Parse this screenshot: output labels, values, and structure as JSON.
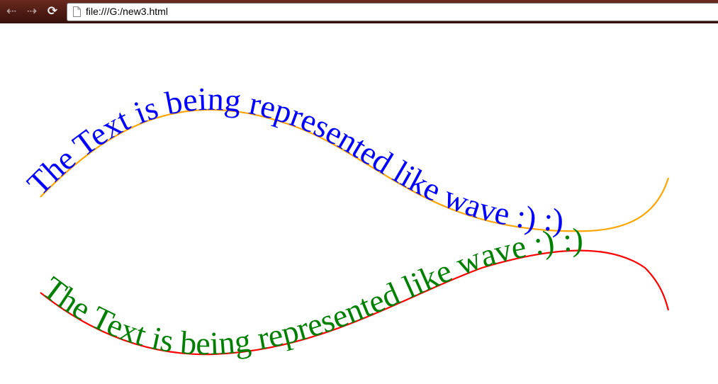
{
  "browser": {
    "url": "file:///G:/new3.html",
    "icons": {
      "back": "back-arrow-icon",
      "forward": "forward-arrow-icon",
      "reload": "reload-icon",
      "page": "page-icon"
    }
  },
  "waves": [
    {
      "text": "The Text is being represented like wave :) :)",
      "text_color": "#0000ff",
      "path_color": "#ffa500"
    },
    {
      "text": "The Text is being represented like wave :) :)",
      "text_color": "#008000",
      "path_color": "#ff0000"
    }
  ]
}
